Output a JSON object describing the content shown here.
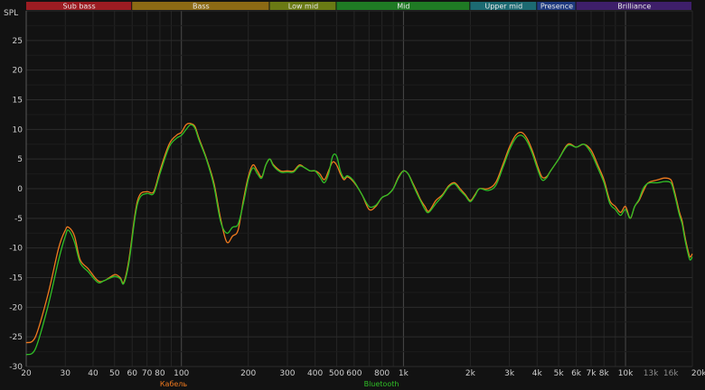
{
  "chart_data": {
    "type": "line",
    "xscale": "log",
    "xlim": [
      20,
      20000
    ],
    "ylim": [
      -30,
      30
    ],
    "ylabel": "SPL",
    "grid": true,
    "legend_position": "bottom-center",
    "bands": [
      {
        "label": "Sub bass",
        "from": 20,
        "to": 60,
        "color": "#9c1c22"
      },
      {
        "label": "Bass",
        "from": 60,
        "to": 250,
        "color": "#8c6a14"
      },
      {
        "label": "Low mid",
        "from": 250,
        "to": 500,
        "color": "#6a7a14"
      },
      {
        "label": "Mid",
        "from": 500,
        "to": 2000,
        "color": "#1f7a24"
      },
      {
        "label": "Upper mid",
        "from": 2000,
        "to": 4000,
        "color": "#1c6a72"
      },
      {
        "label": "Presence",
        "from": 4000,
        "to": 6000,
        "color": "#1f3a80"
      },
      {
        "label": "Brilliance",
        "from": 6000,
        "to": 20000,
        "color": "#3e1f6a"
      }
    ],
    "x_ticks": [
      {
        "v": 20,
        "label": "20"
      },
      {
        "v": 30,
        "label": "30"
      },
      {
        "v": 40,
        "label": "40"
      },
      {
        "v": 50,
        "label": "50"
      },
      {
        "v": 60,
        "label": "60"
      },
      {
        "v": 70,
        "label": "70"
      },
      {
        "v": 80,
        "label": "80"
      },
      {
        "v": 100,
        "label": "100"
      },
      {
        "v": 200,
        "label": "200"
      },
      {
        "v": 300,
        "label": "300"
      },
      {
        "v": 400,
        "label": "400"
      },
      {
        "v": 500,
        "label": "500"
      },
      {
        "v": 600,
        "label": "600"
      },
      {
        "v": 800,
        "label": "800"
      },
      {
        "v": 1000,
        "label": "1k"
      },
      {
        "v": 2000,
        "label": "2k"
      },
      {
        "v": 3000,
        "label": "3k"
      },
      {
        "v": 4000,
        "label": "4k"
      },
      {
        "v": 5000,
        "label": "5k"
      },
      {
        "v": 6000,
        "label": "6k"
      },
      {
        "v": 7000,
        "label": "7k"
      },
      {
        "v": 8000,
        "label": "8k"
      },
      {
        "v": 10000,
        "label": "10k"
      },
      {
        "v": 13000,
        "label": "13k"
      },
      {
        "v": 16000,
        "label": "16k"
      },
      {
        "v": 20000,
        "label": "20kHz"
      }
    ],
    "y_ticks": [
      -30,
      -25,
      -20,
      -15,
      -10,
      -5,
      0,
      5,
      10,
      15,
      20,
      25
    ],
    "series": [
      {
        "name": "Кабель",
        "color": "#f07a1e",
        "points": [
          [
            20,
            -26
          ],
          [
            22,
            -25
          ],
          [
            25,
            -18
          ],
          [
            28,
            -10
          ],
          [
            30,
            -7
          ],
          [
            31,
            -6.5
          ],
          [
            33,
            -8
          ],
          [
            35,
            -12
          ],
          [
            38,
            -13.5
          ],
          [
            42,
            -15.5
          ],
          [
            45,
            -15.5
          ],
          [
            50,
            -14.5
          ],
          [
            53,
            -15
          ],
          [
            55,
            -15.8
          ],
          [
            58,
            -12
          ],
          [
            62,
            -4
          ],
          [
            65,
            -1
          ],
          [
            70,
            -0.5
          ],
          [
            75,
            -0.5
          ],
          [
            80,
            3
          ],
          [
            88,
            7.5
          ],
          [
            95,
            9
          ],
          [
            100,
            9.5
          ],
          [
            105,
            10.8
          ],
          [
            110,
            11
          ],
          [
            115,
            10.5
          ],
          [
            120,
            8.5
          ],
          [
            130,
            5
          ],
          [
            140,
            1
          ],
          [
            150,
            -5
          ],
          [
            160,
            -9
          ],
          [
            170,
            -8
          ],
          [
            180,
            -7
          ],
          [
            190,
            -2
          ],
          [
            200,
            2
          ],
          [
            210,
            4
          ],
          [
            220,
            3
          ],
          [
            230,
            2
          ],
          [
            240,
            4
          ],
          [
            250,
            5
          ],
          [
            260,
            4
          ],
          [
            280,
            3
          ],
          [
            300,
            3
          ],
          [
            320,
            3
          ],
          [
            340,
            4
          ],
          [
            360,
            3.5
          ],
          [
            380,
            3
          ],
          [
            400,
            3
          ],
          [
            420,
            2.5
          ],
          [
            440,
            1.5
          ],
          [
            460,
            3
          ],
          [
            480,
            4.5
          ],
          [
            500,
            4
          ],
          [
            520,
            2.5
          ],
          [
            540,
            1.5
          ],
          [
            560,
            2
          ],
          [
            600,
            1
          ],
          [
            650,
            -1
          ],
          [
            700,
            -3.5
          ],
          [
            750,
            -3
          ],
          [
            800,
            -1.5
          ],
          [
            850,
            -1
          ],
          [
            900,
            0
          ],
          [
            950,
            2
          ],
          [
            1000,
            3
          ],
          [
            1050,
            2.5
          ],
          [
            1100,
            1
          ],
          [
            1150,
            -0.5
          ],
          [
            1200,
            -2
          ],
          [
            1250,
            -3
          ],
          [
            1300,
            -3.8
          ],
          [
            1400,
            -2
          ],
          [
            1500,
            -1
          ],
          [
            1600,
            0.5
          ],
          [
            1700,
            1
          ],
          [
            1800,
            0
          ],
          [
            1900,
            -1
          ],
          [
            2000,
            -2
          ],
          [
            2100,
            -1
          ],
          [
            2200,
            0
          ],
          [
            2400,
            0
          ],
          [
            2600,
            1
          ],
          [
            2800,
            4
          ],
          [
            3000,
            7
          ],
          [
            3200,
            9
          ],
          [
            3400,
            9.5
          ],
          [
            3600,
            8.5
          ],
          [
            3800,
            6.5
          ],
          [
            4000,
            4
          ],
          [
            4200,
            2
          ],
          [
            4400,
            2
          ],
          [
            4600,
            3
          ],
          [
            5000,
            5
          ],
          [
            5500,
            7.5
          ],
          [
            6000,
            7
          ],
          [
            6500,
            7.5
          ],
          [
            7000,
            6.5
          ],
          [
            7500,
            4
          ],
          [
            8000,
            1.5
          ],
          [
            8500,
            -2
          ],
          [
            9000,
            -3
          ],
          [
            9500,
            -4
          ],
          [
            10000,
            -3
          ],
          [
            10500,
            -5
          ],
          [
            11000,
            -3
          ],
          [
            11500,
            -2
          ],
          [
            12000,
            -0.5
          ],
          [
            12500,
            0.8
          ],
          [
            13000,
            1.2
          ],
          [
            14000,
            1.5
          ],
          [
            15000,
            1.8
          ],
          [
            16000,
            1.5
          ],
          [
            16500,
            0
          ],
          [
            17000,
            -2
          ],
          [
            17500,
            -4
          ],
          [
            18000,
            -5.5
          ],
          [
            18500,
            -8
          ],
          [
            19000,
            -10
          ],
          [
            19500,
            -11.5
          ],
          [
            20000,
            -11
          ]
        ]
      },
      {
        "name": "Bluetooth",
        "color": "#2fbf26",
        "points": [
          [
            20,
            -28
          ],
          [
            22,
            -27
          ],
          [
            25,
            -20
          ],
          [
            28,
            -12
          ],
          [
            30,
            -8
          ],
          [
            31,
            -7
          ],
          [
            33,
            -9
          ],
          [
            35,
            -12.5
          ],
          [
            38,
            -14
          ],
          [
            42,
            -15.8
          ],
          [
            45,
            -15.5
          ],
          [
            50,
            -14.8
          ],
          [
            53,
            -15.2
          ],
          [
            55,
            -16
          ],
          [
            58,
            -12.5
          ],
          [
            62,
            -4.5
          ],
          [
            65,
            -1.5
          ],
          [
            70,
            -0.8
          ],
          [
            75,
            -0.8
          ],
          [
            80,
            2.5
          ],
          [
            88,
            7
          ],
          [
            95,
            8.5
          ],
          [
            100,
            9
          ],
          [
            105,
            10
          ],
          [
            110,
            10.8
          ],
          [
            115,
            10.2
          ],
          [
            120,
            8.2
          ],
          [
            130,
            4.8
          ],
          [
            140,
            0.5
          ],
          [
            150,
            -5.5
          ],
          [
            160,
            -7.5
          ],
          [
            170,
            -6.5
          ],
          [
            180,
            -6
          ],
          [
            190,
            -2.5
          ],
          [
            200,
            1.5
          ],
          [
            210,
            3.5
          ],
          [
            220,
            2.5
          ],
          [
            230,
            1.8
          ],
          [
            240,
            4
          ],
          [
            250,
            5
          ],
          [
            260,
            3.8
          ],
          [
            280,
            2.8
          ],
          [
            300,
            2.8
          ],
          [
            320,
            2.8
          ],
          [
            340,
            3.8
          ],
          [
            360,
            3.5
          ],
          [
            380,
            3
          ],
          [
            400,
            3
          ],
          [
            420,
            2
          ],
          [
            440,
            1
          ],
          [
            460,
            2.5
          ],
          [
            480,
            5.5
          ],
          [
            500,
            5.5
          ],
          [
            520,
            3
          ],
          [
            540,
            1.8
          ],
          [
            560,
            2.2
          ],
          [
            600,
            1.2
          ],
          [
            650,
            -1
          ],
          [
            700,
            -3
          ],
          [
            750,
            -2.8
          ],
          [
            800,
            -1.5
          ],
          [
            850,
            -1
          ],
          [
            900,
            0
          ],
          [
            950,
            1.8
          ],
          [
            1000,
            3
          ],
          [
            1050,
            2.5
          ],
          [
            1100,
            0.8
          ],
          [
            1150,
            -0.8
          ],
          [
            1200,
            -2.2
          ],
          [
            1250,
            -3.5
          ],
          [
            1300,
            -4
          ],
          [
            1400,
            -2.5
          ],
          [
            1500,
            -1.2
          ],
          [
            1600,
            0.3
          ],
          [
            1700,
            0.8
          ],
          [
            1800,
            -0.3
          ],
          [
            1900,
            -1.2
          ],
          [
            2000,
            -2.2
          ],
          [
            2100,
            -1.2
          ],
          [
            2200,
            0
          ],
          [
            2400,
            -0.3
          ],
          [
            2600,
            0.5
          ],
          [
            2800,
            3.5
          ],
          [
            3000,
            6.5
          ],
          [
            3200,
            8.5
          ],
          [
            3400,
            9
          ],
          [
            3600,
            8
          ],
          [
            3800,
            6
          ],
          [
            4000,
            3.5
          ],
          [
            4200,
            1.5
          ],
          [
            4400,
            1.8
          ],
          [
            4600,
            3
          ],
          [
            5000,
            5
          ],
          [
            5500,
            7.3
          ],
          [
            6000,
            7
          ],
          [
            6500,
            7.5
          ],
          [
            7000,
            6
          ],
          [
            7500,
            3.5
          ],
          [
            8000,
            1
          ],
          [
            8500,
            -2.5
          ],
          [
            9000,
            -3.5
          ],
          [
            9500,
            -4.5
          ],
          [
            10000,
            -3.5
          ],
          [
            10500,
            -5
          ],
          [
            11000,
            -3
          ],
          [
            11500,
            -1.8
          ],
          [
            12000,
            0
          ],
          [
            12500,
            0.8
          ],
          [
            13000,
            1
          ],
          [
            14000,
            1
          ],
          [
            15000,
            1.2
          ],
          [
            16000,
            1
          ],
          [
            16500,
            -0.5
          ],
          [
            17000,
            -2.5
          ],
          [
            17500,
            -4.5
          ],
          [
            18000,
            -6
          ],
          [
            18500,
            -8.5
          ],
          [
            19000,
            -10.5
          ],
          [
            19500,
            -12
          ],
          [
            20000,
            -11.5
          ]
        ]
      }
    ]
  }
}
